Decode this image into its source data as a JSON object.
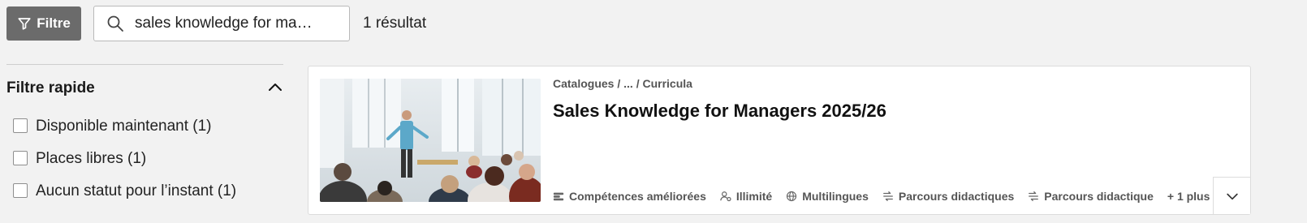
{
  "toolbar": {
    "filter_label": "Filtre",
    "search_value": "sales knowledge for ma…",
    "result_count": "1 résultat"
  },
  "sidebar": {
    "quick_filter_title": "Filtre rapide",
    "options": [
      {
        "label": "Disponible maintenant (1)",
        "checked": false
      },
      {
        "label": "Places libres (1)",
        "checked": false
      },
      {
        "label": "Aucun statut pour l’instant (1)",
        "checked": false
      }
    ]
  },
  "results": [
    {
      "breadcrumb": "Catalogues / ... / Curricula",
      "title": "Sales Knowledge for Managers 2025/26",
      "tags": [
        {
          "label": "Compétences améliorées",
          "icon": "skills-icon"
        },
        {
          "label": "Illimité",
          "icon": "person-unlimited-icon"
        },
        {
          "label": "Multilingues",
          "icon": "globe-icon"
        },
        {
          "label": "Parcours didactiques",
          "icon": "path-icon"
        },
        {
          "label": "Parcours didactique",
          "icon": "path-icon"
        }
      ],
      "more_label": "+ 1 plus"
    }
  ],
  "colors": {
    "filter_button_bg": "#6b6b6b",
    "page_bg": "#f2f2f2",
    "card_bg": "#ffffff"
  }
}
